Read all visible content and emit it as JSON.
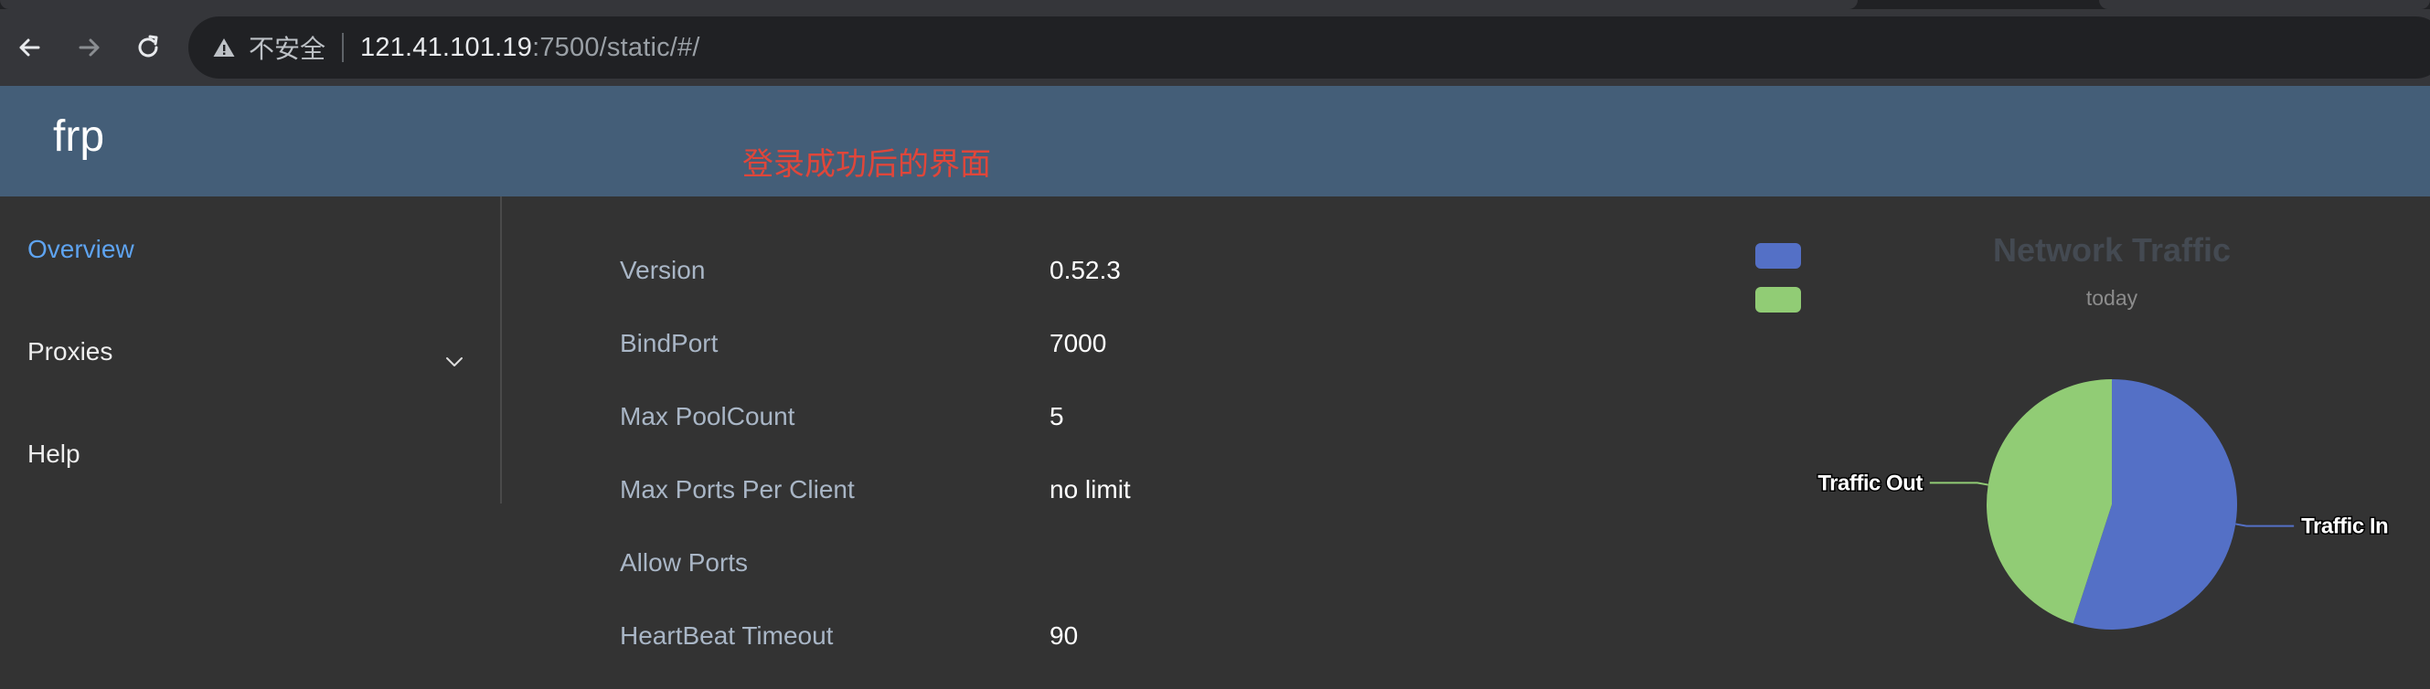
{
  "browser": {
    "security_label": "不安全",
    "url_host": "121.41.101.19",
    "url_rest": ":7500/static/#/"
  },
  "header": {
    "brand": "frp",
    "annotation": "登录成功后的界面"
  },
  "sidebar": {
    "items": [
      {
        "label": "Overview",
        "active": true
      },
      {
        "label": "Proxies",
        "expandable": true
      },
      {
        "label": "Help"
      }
    ]
  },
  "overview": {
    "rows": [
      {
        "label": "Version",
        "value": "0.52.3"
      },
      {
        "label": "BindPort",
        "value": "7000"
      },
      {
        "label": "Max PoolCount",
        "value": "5"
      },
      {
        "label": "Max Ports Per Client",
        "value": "no limit"
      },
      {
        "label": "Allow Ports",
        "value": ""
      },
      {
        "label": "HeartBeat Timeout",
        "value": "90"
      }
    ]
  },
  "colors": {
    "header_bg": "#445e78",
    "page_bg": "#333333",
    "active_link": "#5ea3f0",
    "traffic_in": "#5470c6",
    "traffic_out": "#91cc75",
    "annotation": "#e0463a"
  },
  "chart_data": {
    "type": "pie",
    "title": "Network Traffic",
    "subtitle": "today",
    "legend_placement": "top-left",
    "legend_labels_visible": false,
    "slices": [
      {
        "name": "Traffic In",
        "value": 55,
        "color": "#5470c6"
      },
      {
        "name": "Traffic Out",
        "value": 45,
        "color": "#91cc75"
      }
    ]
  }
}
